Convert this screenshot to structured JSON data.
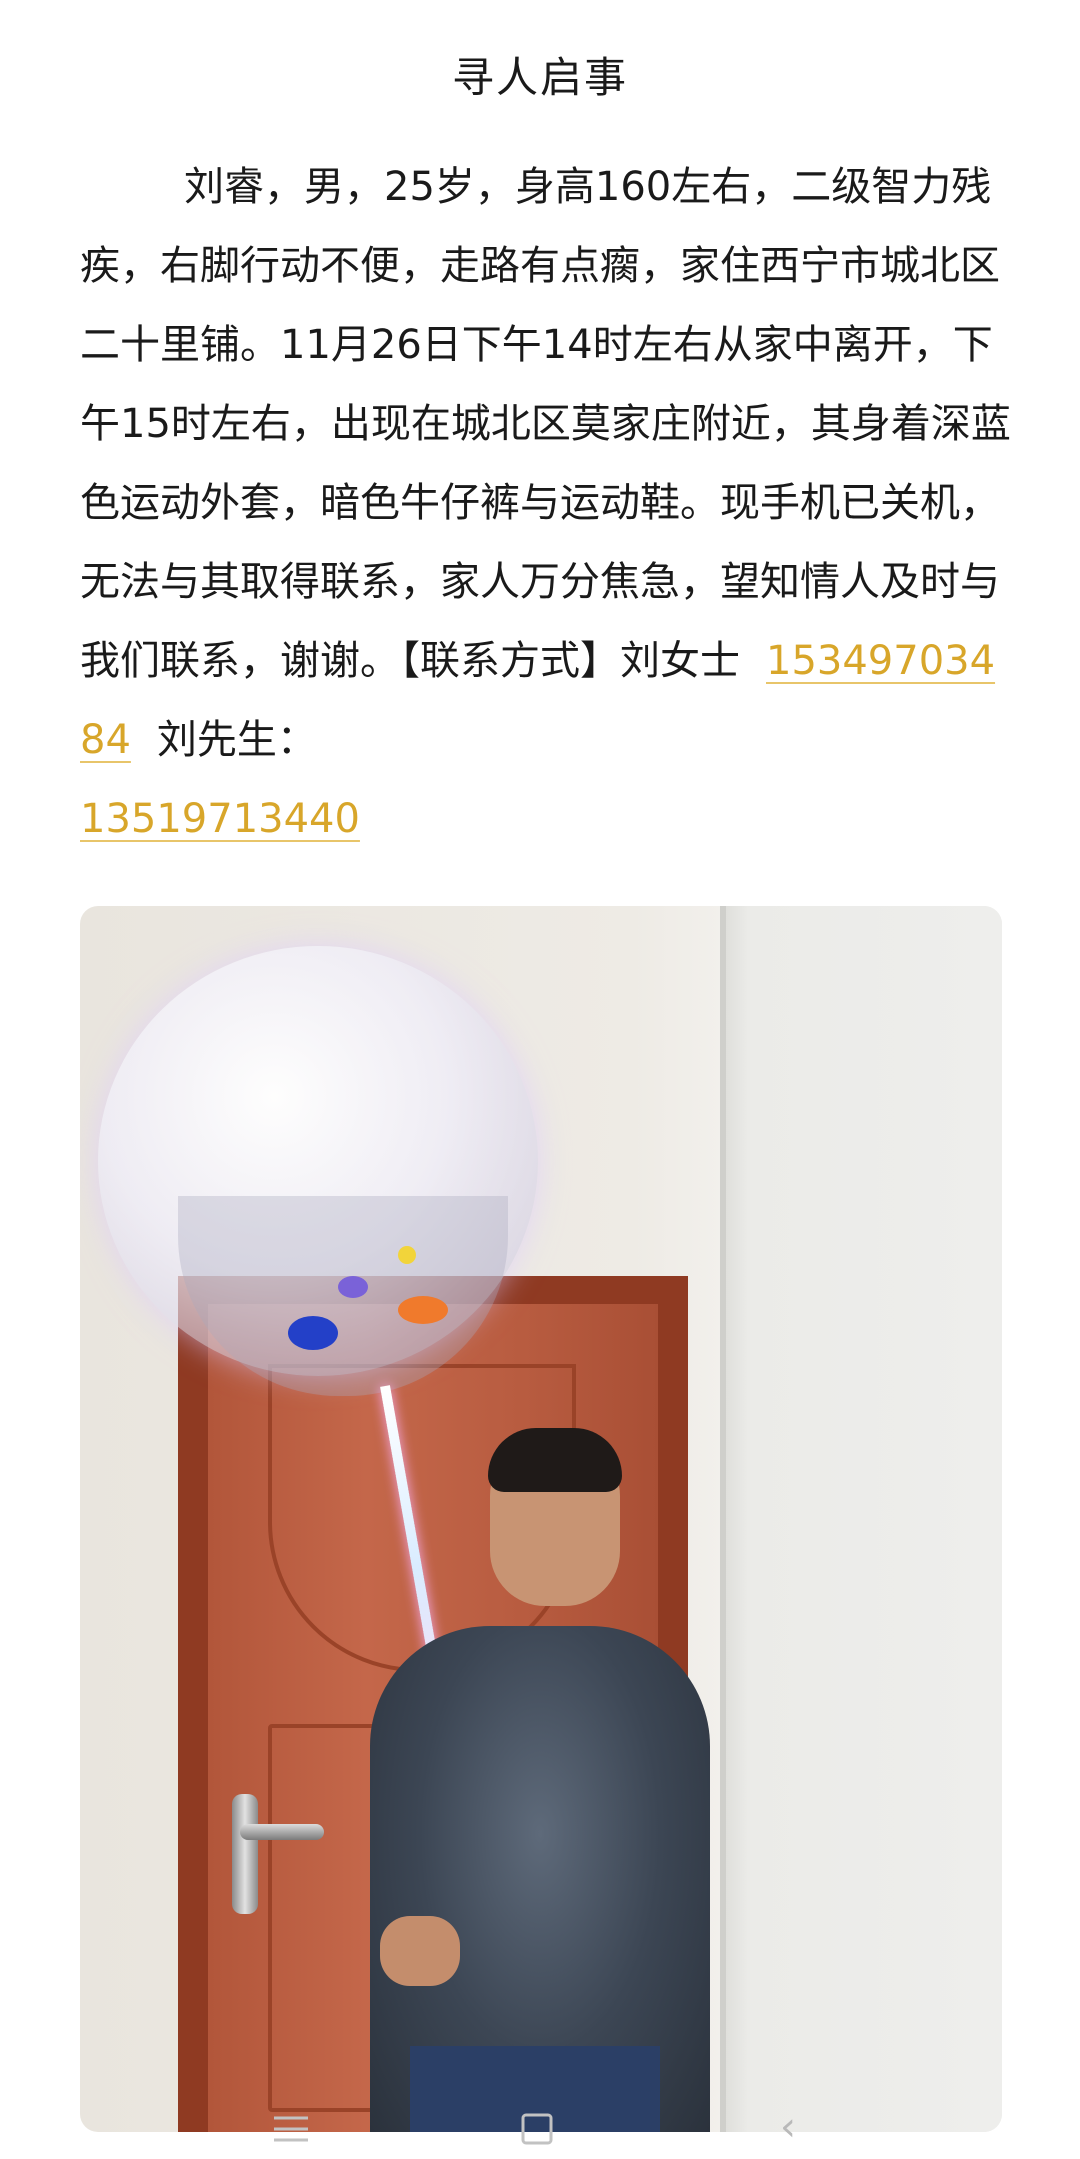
{
  "notice": {
    "title": "寻人启事",
    "body_intro": "刘睿，男，25岁，身高160左右，二级智力残疾，右脚行动不便，走路有点瘸，家住西宁市城北区二十里铺。11月26日下午14时左右从家中离开，下午15时左右，出现在城北区莫家庄附近，其身着深蓝色运动外套，暗色牛仔裤与运动鞋。现手机已关机，无法与其取得联系，家人万分焦急，望知情人及时与我们联系，谢谢。【联系方式】刘女士",
    "phone_1": "15349703484",
    "contact_2_label": "刘先生：",
    "phone_2": "13519713440"
  },
  "colors": {
    "link": "#d8a62a",
    "text": "#1a1a1a",
    "background": "#ffffff"
  },
  "nav": {
    "menu_icon": "menu-icon",
    "home_icon": "home-icon",
    "back_glyph": "‹"
  }
}
